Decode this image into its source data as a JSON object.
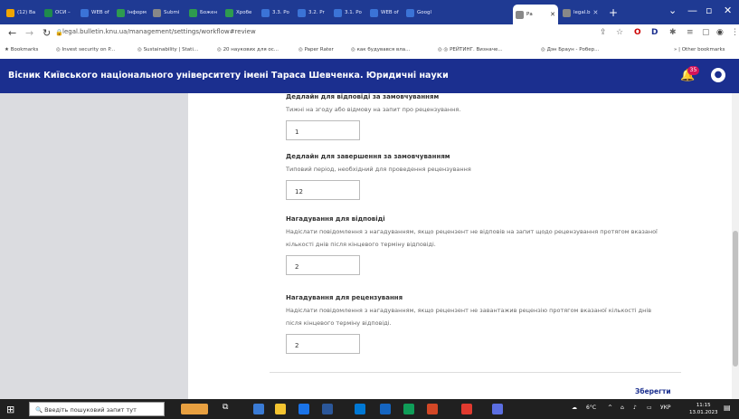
{
  "browser": {
    "tabs": [
      {
        "label": "(12) Ва",
        "color": "#f0a500"
      },
      {
        "label": "ОСИ –",
        "color": "#1f8b4c"
      },
      {
        "label": "WEB of",
        "color": "#3b73d6"
      },
      {
        "label": "Інформ",
        "color": "#2e9b4f"
      },
      {
        "label": "Submi",
        "color": "#888888"
      },
      {
        "label": "Божен",
        "color": "#2e9b4f"
      },
      {
        "label": "Хробе",
        "color": "#2e9b4f"
      },
      {
        "label": "3.3. Ро",
        "color": "#3b73d6"
      },
      {
        "label": "3.2. Pr",
        "color": "#3b73d6"
      },
      {
        "label": "3.1. Ро",
        "color": "#3b73d6"
      },
      {
        "label": "WEB of",
        "color": "#3b73d6"
      },
      {
        "label": "Googl",
        "color": "#3b73d6"
      },
      {
        "label": "Ра",
        "color": "#888888"
      },
      {
        "label": "legal.b",
        "color": "#888888"
      }
    ],
    "new_tab_label": "+",
    "url": "legal.bulletin.knu.ua/management/settings/workflow#review",
    "bookmarks": [
      {
        "label": "Bookmarks"
      },
      {
        "label": "Invest security on P..."
      },
      {
        "label": "Sustainability | Stati..."
      },
      {
        "label": "20 наукових для ос..."
      },
      {
        "label": "Paper Rater"
      },
      {
        "label": "как будувався вла..."
      },
      {
        "label": "РЕЙТИНГ. Визначе..."
      },
      {
        "label": "Дэн Браун - Робер..."
      }
    ],
    "other_bookmarks": "Other bookmarks"
  },
  "app": {
    "title": "Вісник Київського національного університету імені Тараса Шевченка. Юридичні науки",
    "notification_count": "35"
  },
  "form": {
    "fields": [
      {
        "label": "Дедлайн для відповіді за замовчуванням",
        "description": "Тижні на згоду або відмову на запит про рецензування.",
        "value": "1"
      },
      {
        "label": "Дедлайн для завершення за замовчуванням",
        "description": "Типовий період, необхідний для проведення рецензування",
        "value": "12"
      },
      {
        "label": "Нагадування для відповіді",
        "description": "Надіслати повідомлення з нагадуванням, якщо рецензент не відповів на запит щодо рецензування протягом вказаної кількості днів після кінцевого терміну відповіді.",
        "value": "2"
      },
      {
        "label": "Нагадування для рецензування",
        "description": "Надіслати повідомлення з нагадуванням, якщо рецензент не завантажив рецензію протягом вказаної кількості днів після кінцевого терміну відповіді.",
        "value": "2"
      }
    ],
    "save_label": "Зберегти"
  },
  "taskbar": {
    "search_placeholder": "Введіть пошуковий запит тут",
    "weather": "6°C",
    "language": "УКР",
    "time": "11:15",
    "date": "13.01.2023"
  },
  "colors": {
    "brand": "#1b2f8f",
    "tabbar": "#1f3a93",
    "notification_badge": "#d4145a"
  }
}
